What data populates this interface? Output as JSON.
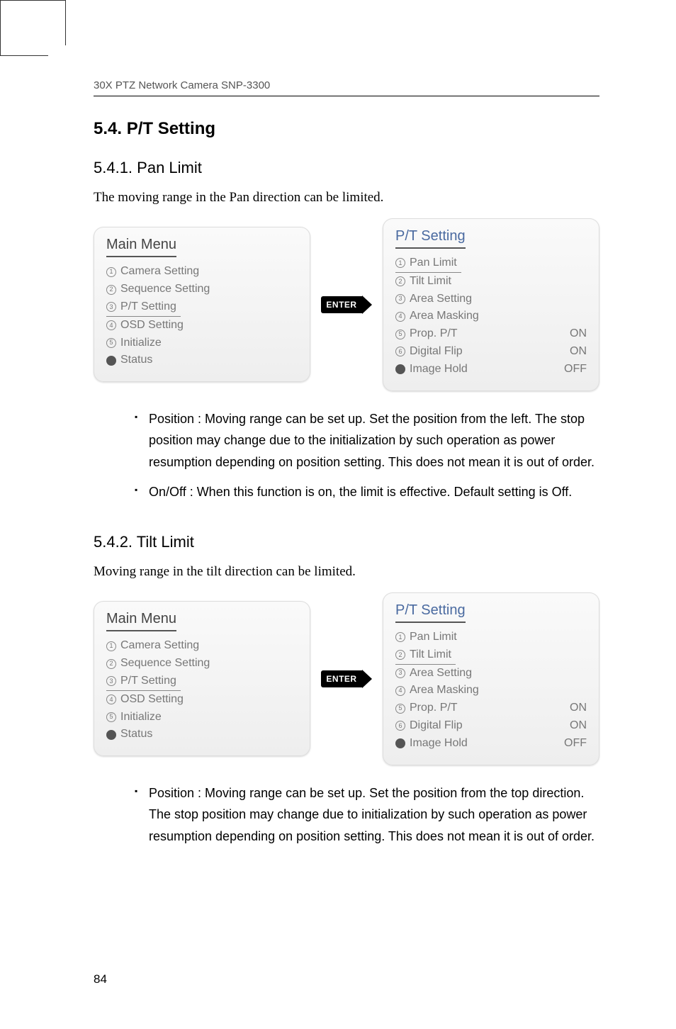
{
  "header": {
    "text": "30X PTZ Network Camera SNP-3300"
  },
  "section": {
    "title": "5.4. P/T Setting"
  },
  "sub1": {
    "title": "5.4.1. Pan Limit",
    "intro": "The moving range in the Pan direction can be limited.",
    "mainMenu": {
      "title": "Main Menu",
      "items": [
        {
          "n": "①",
          "label": "Camera Setting"
        },
        {
          "n": "②",
          "label": "Sequence Setting"
        },
        {
          "n": "③",
          "label": "P/T Setting",
          "underline": true
        },
        {
          "n": "④",
          "label": "OSD Setting"
        },
        {
          "n": "⑤",
          "label": "Initialize"
        },
        {
          "n": "●",
          "label": "Status",
          "black": true
        }
      ]
    },
    "enter": "ENTER",
    "ptMenu": {
      "title": "P/T Setting",
      "items": [
        {
          "n": "①",
          "label": "Pan Limit",
          "underline": true
        },
        {
          "n": "②",
          "label": "Tilt Limit"
        },
        {
          "n": "③",
          "label": "Area Setting"
        },
        {
          "n": "④",
          "label": "Area Masking"
        },
        {
          "n": "⑤",
          "label": "Prop. P/T",
          "value": "ON"
        },
        {
          "n": "⑥",
          "label": "Digital Flip",
          "value": "ON"
        },
        {
          "n": "●",
          "label": "Image Hold",
          "value": "OFF",
          "black": true
        }
      ]
    },
    "bullets": [
      "Position : Moving range can be set up. Set the position from the left. The stop position may change due to the initialization by such operation as power resumption depending on position setting. This does not mean it is out of order.",
      "On/Off : When this function is on, the limit is effective. Default setting is Off."
    ]
  },
  "sub2": {
    "title": "5.4.2. Tilt Limit",
    "intro": "Moving range in the tilt direction can be limited.",
    "mainMenu": {
      "title": "Main Menu",
      "items": [
        {
          "n": "①",
          "label": "Camera Setting"
        },
        {
          "n": "②",
          "label": "Sequence Setting"
        },
        {
          "n": "③",
          "label": "P/T Setting",
          "underline": true
        },
        {
          "n": "④",
          "label": "OSD Setting"
        },
        {
          "n": "⑤",
          "label": "Initialize"
        },
        {
          "n": "●",
          "label": "Status",
          "black": true
        }
      ]
    },
    "enter": "ENTER",
    "ptMenu": {
      "title": "P/T Setting",
      "items": [
        {
          "n": "①",
          "label": "Pan Limit"
        },
        {
          "n": "②",
          "label": "Tilt Limit",
          "underline": true
        },
        {
          "n": "③",
          "label": "Area Setting"
        },
        {
          "n": "④",
          "label": "Area Masking"
        },
        {
          "n": "⑤",
          "label": "Prop. P/T",
          "value": "ON"
        },
        {
          "n": "⑥",
          "label": "Digital Flip",
          "value": "ON"
        },
        {
          "n": "●",
          "label": "Image Hold",
          "value": "OFF",
          "black": true
        }
      ]
    },
    "bullets": [
      "Position : Moving range can be set up. Set the position from the top direction. The stop position may change due to initialization by such operation as power resumption depending on position setting. This does not mean it is out of order."
    ]
  },
  "pageNumber": "84"
}
